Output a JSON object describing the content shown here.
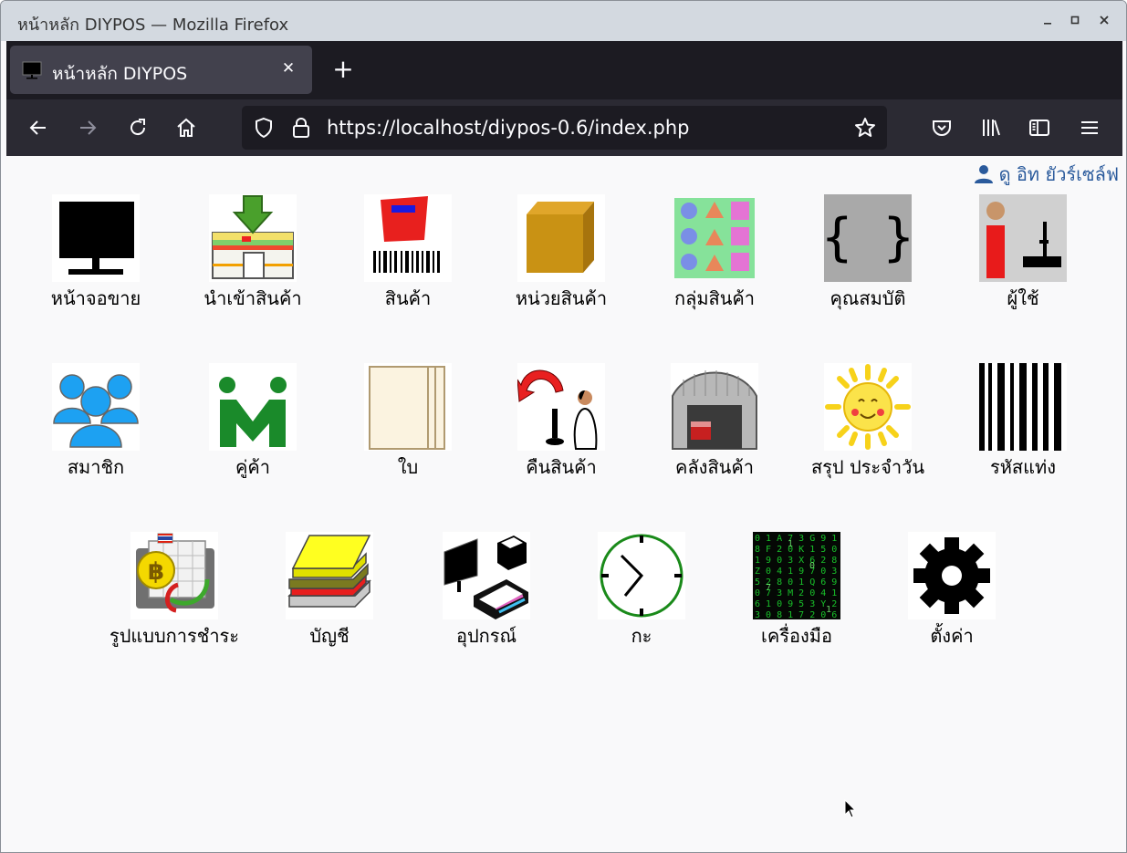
{
  "window": {
    "title": "หน้าหลัก DIYPOS — Mozilla Firefox"
  },
  "tab": {
    "label": "หน้าหลัก DIYPOS"
  },
  "urlbar": {
    "url": "https://localhost/diypos-0.6/index.php"
  },
  "user": {
    "name": "ดู อิท ยัวร์เซล์ฟ"
  },
  "menu": {
    "row1": [
      "หน้าจอขาย",
      "นำเข้าสินค้า",
      "สินค้า",
      "หน่วยสินค้า",
      "กลุ่มสินค้า",
      "คุณสมบัติ",
      "ผู้ใช้"
    ],
    "row2": [
      "สมาชิก",
      "คู่ค้า",
      "ใบ",
      "คืนสินค้า",
      "คลังสินค้า",
      "สรุป ประจำวัน",
      "รหัสแท่ง"
    ],
    "row3": [
      "รูปแบบการชำระ",
      "บัญชี",
      "อุปกรณ์",
      "กะ",
      "เครื่องมือ",
      "ตั้งค่า"
    ]
  }
}
